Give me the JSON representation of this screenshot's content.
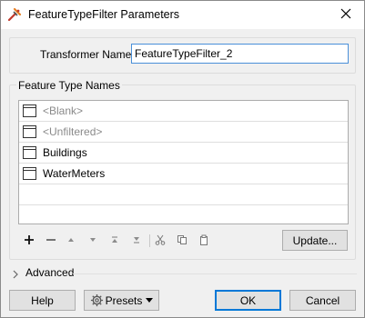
{
  "window": {
    "title": "FeatureTypeFilter Parameters",
    "close_glyph": "✕"
  },
  "transformer": {
    "label": "Transformer Name:",
    "value": "FeatureTypeFilter_2"
  },
  "feature_types": {
    "legend": "Feature Type Names",
    "items": [
      {
        "label": "<Blank>",
        "placeholder": true
      },
      {
        "label": "<Unfiltered>",
        "placeholder": true
      },
      {
        "label": "Buildings",
        "placeholder": false
      },
      {
        "label": "WaterMeters",
        "placeholder": false
      }
    ]
  },
  "toolbar": {
    "icons": [
      "plus-icon",
      "minus-icon",
      "move-up-icon",
      "move-down-icon",
      "move-to-top-icon",
      "move-to-bottom-icon",
      "cut-icon",
      "copy-icon",
      "paste-icon"
    ],
    "update_label": "Update..."
  },
  "advanced": {
    "label": "Advanced"
  },
  "footer": {
    "help_label": "Help",
    "presets_label": "Presets",
    "ok_label": "OK",
    "cancel_label": "Cancel"
  },
  "colors": {
    "accent": "#0078d7",
    "input_border": "#4a90d9",
    "window_bg": "#f0f0f0"
  }
}
